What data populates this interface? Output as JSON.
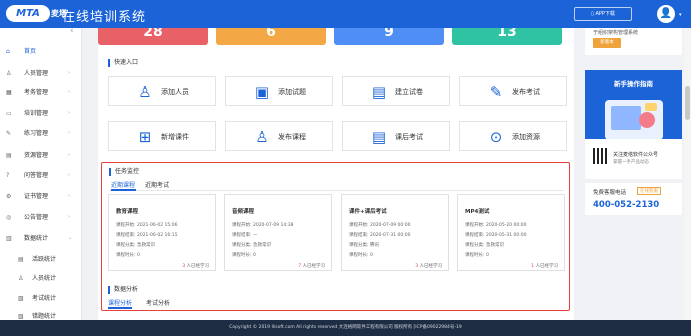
{
  "header": {
    "logo_text": "MTA",
    "logo_cn": "麦塔",
    "title": "在线培训系统",
    "app_download": "APP下载",
    "avatar_icon": "user-avatar-icon"
  },
  "sidebar": {
    "items": [
      {
        "label": "首页",
        "icon": "home-icon",
        "glyph": "⌂",
        "active": true
      },
      {
        "label": "人员管理",
        "icon": "user-icon",
        "glyph": "♙"
      },
      {
        "label": "考务管理",
        "icon": "calendar-icon",
        "glyph": "▦"
      },
      {
        "label": "培训管理",
        "icon": "monitor-icon",
        "glyph": "▭"
      },
      {
        "label": "练习管理",
        "icon": "edit-icon",
        "glyph": "✎"
      },
      {
        "label": "资源管理",
        "icon": "folder-icon",
        "glyph": "▤"
      },
      {
        "label": "问答管理",
        "icon": "question-icon",
        "glyph": "?"
      },
      {
        "label": "证书管理",
        "icon": "certificate-icon",
        "glyph": "⚙"
      },
      {
        "label": "公告管理",
        "icon": "notice-icon",
        "glyph": "◎"
      },
      {
        "label": "数据统计",
        "icon": "stats-icon",
        "glyph": "▥"
      }
    ],
    "sub_items": [
      {
        "label": "活跃统计",
        "icon": "bar-chart-icon",
        "glyph": "▤"
      },
      {
        "label": "人员统计",
        "icon": "person-stat-icon",
        "glyph": "♙"
      },
      {
        "label": "考试统计",
        "icon": "exam-stat-icon",
        "glyph": "▨"
      },
      {
        "label": "错题统计",
        "icon": "wrong-stat-icon",
        "glyph": "▧"
      }
    ]
  },
  "stats": [
    {
      "value": "28",
      "color": "#e86166"
    },
    {
      "value": "6",
      "color": "#f3a845"
    },
    {
      "value": "9",
      "color": "#4f8ff5"
    },
    {
      "value": "13",
      "color": "#2fc3a3"
    }
  ],
  "quick_entry": {
    "title": "快速入口",
    "items": [
      {
        "label": "添加人员",
        "icon": "add-user-icon",
        "glyph": "♙"
      },
      {
        "label": "添加试题",
        "icon": "add-question-icon",
        "glyph": "▣"
      },
      {
        "label": "建立试卷",
        "icon": "create-paper-icon",
        "glyph": "▤"
      },
      {
        "label": "发布考试",
        "icon": "publish-exam-icon",
        "glyph": "✎"
      },
      {
        "label": "新增课件",
        "icon": "add-courseware-icon",
        "glyph": "⊞"
      },
      {
        "label": "发布课程",
        "icon": "publish-course-icon",
        "glyph": "♙"
      },
      {
        "label": "课后考试",
        "icon": "post-course-exam-icon",
        "glyph": "▤"
      },
      {
        "label": "添加资源",
        "icon": "add-resource-icon",
        "glyph": "⊙"
      }
    ]
  },
  "task_monitor": {
    "title": "任务监控",
    "tabs": [
      "近期课程",
      "近期考试"
    ],
    "cards": [
      {
        "title": "教育课程",
        "start_label": "课程开始:",
        "start": "2021-06-02 15:06",
        "end_label": "课程结束:",
        "end": "2021-06-02 16:15",
        "cat_label": "课程分类:",
        "cat": "急救常识",
        "dur_label": "课程时长:",
        "dur": "0",
        "count": "3",
        "count_suffix": "人已经学习"
      },
      {
        "title": "音频课程",
        "start_label": "课程开始:",
        "start": "2020-07-09 14:38",
        "end_label": "课程结束:",
        "end": "—",
        "cat_label": "课程分类:",
        "cat": "急救常识",
        "dur_label": "课程时长:",
        "dur": "0",
        "count": "7",
        "count_suffix": "人已经学习"
      },
      {
        "title": "课件+课后考试",
        "start_label": "课程开始:",
        "start": "2020-07-09 00:00",
        "end_label": "课程结束:",
        "end": "2020-07-31 00:00",
        "cat_label": "课程分类:",
        "cat": "腾讯",
        "dur_label": "课程时长:",
        "dur": "0",
        "count": "3",
        "count_suffix": "人已经学习"
      },
      {
        "title": "MP4测试",
        "start_label": "课程开始:",
        "start": "2020-05-20 00:00",
        "end_label": "课程结束:",
        "end": "2020-05-31 00:00",
        "cat_label": "课程分类:",
        "cat": "急救常识",
        "dur_label": "课程时长:",
        "dur": "0",
        "count": "1",
        "count_suffix": "人已经学习"
      }
    ]
  },
  "data_analysis": {
    "title": "数据分析",
    "tabs": [
      "课程分析",
      "考试分析"
    ]
  },
  "right_panel": {
    "top_text": "于组织架构管理系统",
    "top_button": "新版本",
    "guide_title": "新手操作指南",
    "wechat_line1": "关注麦塔软件公众号",
    "wechat_line2": "掌握一手产品动态",
    "hotline_label": "免费客服电话",
    "hotline_badge": "在线客服",
    "hotline_number": "400-052-2130"
  },
  "footer": {
    "text": "Copyright © 2019 Ilisoft.com All rights reserved 大连格网软件工程有限公司 版权所有 [ICP备09022984号-19"
  },
  "colors": {
    "brand": "#1c63d8",
    "highlight_border": "#e8403a",
    "footer_bg": "#1f2d44"
  }
}
